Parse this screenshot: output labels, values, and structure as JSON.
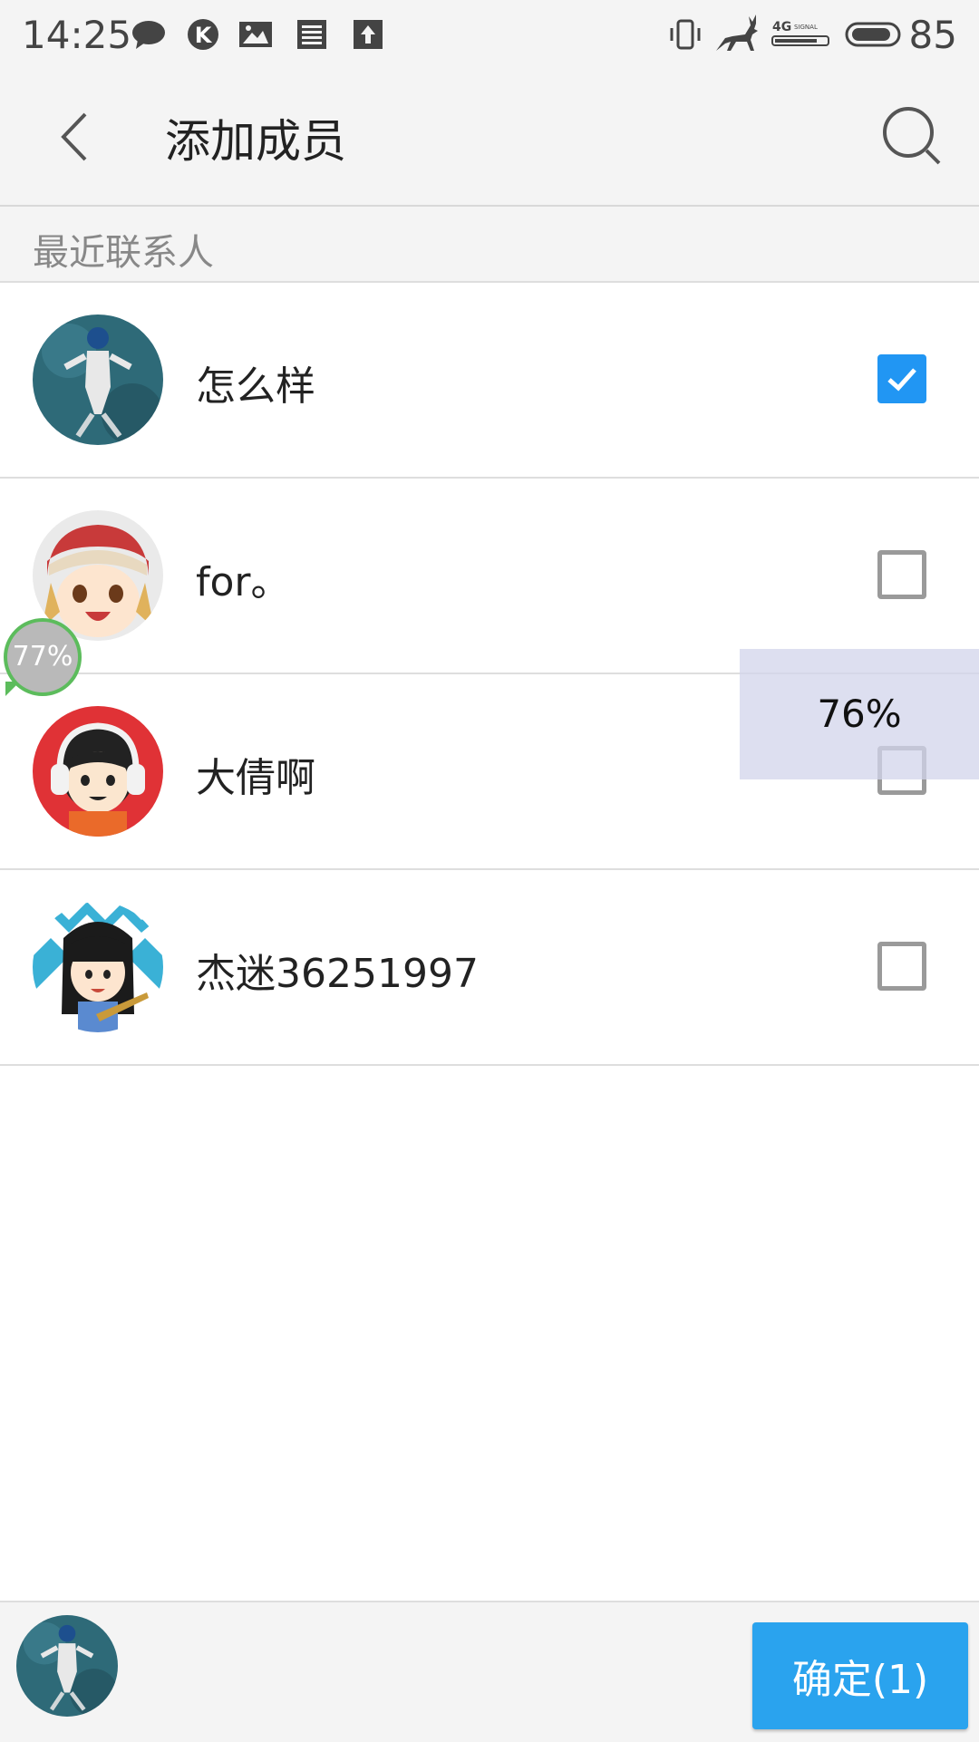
{
  "status_bar": {
    "time": "14:25",
    "battery": "85",
    "network": "4G"
  },
  "header": {
    "title": "添加成员"
  },
  "section": {
    "label": "最近联系人"
  },
  "contacts": [
    {
      "name": "怎么样",
      "checked": true
    },
    {
      "name": "for。",
      "checked": false
    },
    {
      "name": "大倩啊",
      "checked": false
    },
    {
      "name": "杰迷36251997",
      "checked": false
    }
  ],
  "overlays": {
    "bubble_percent": "77%",
    "panel_percent": "76%"
  },
  "footer": {
    "confirm_label": "确定(1)"
  },
  "colors": {
    "accent": "#2196F3",
    "confirm": "#2aa3ee",
    "bubble_ring": "#5cbc5c"
  }
}
